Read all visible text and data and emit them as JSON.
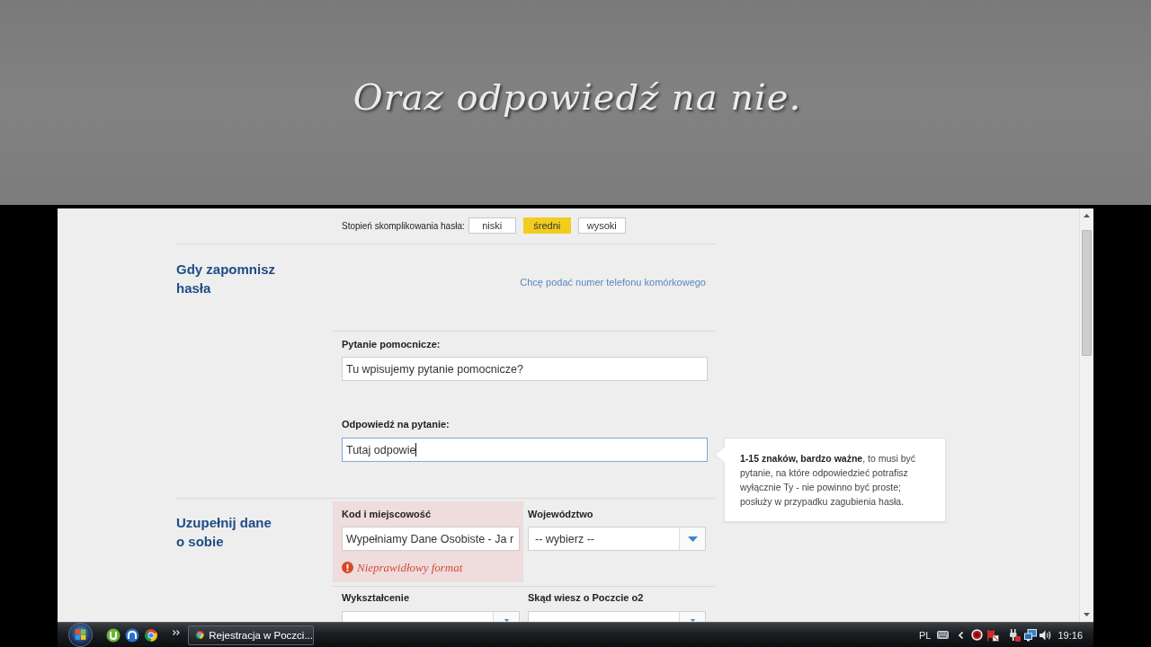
{
  "caption": {
    "text": "Oraz odpowiedź na nie."
  },
  "password_strength": {
    "label": "Stopień skomplikowania hasła:",
    "levels": [
      {
        "label": "niski",
        "selected": false
      },
      {
        "label": "średni",
        "selected": true
      },
      {
        "label": "wysoki",
        "selected": false
      }
    ]
  },
  "recovery_section": {
    "heading": "Gdy zapomnisz hasła",
    "phone_link": "Chcę podać numer telefonu komórkowego",
    "fields": [
      {
        "label": "Pytanie pomocnicze:",
        "value": "Tu wpisujemy pytanie pomocnicze?",
        "focused": false
      },
      {
        "label": "Odpowiedź na pytanie:",
        "value": "Tutaj odpowie",
        "focused": true,
        "tooltip": "**1-15 znaków, bardzo ważne**, to musi być pytanie, na które odpowiedzieć potrafisz wyłącznie Ty - nie powinno być proste; posłuży w przypadku zagubienia hasła."
      }
    ]
  },
  "personal_section": {
    "heading": "Uzupełnij dane o sobie",
    "rows": [
      [
        {
          "kind": "text",
          "label": "Kod i miejscowość",
          "value": "Wypełniamy Dane Osobiste - Ja r",
          "error": "Nieprawidłowy format"
        },
        {
          "kind": "select",
          "label": "Województwo",
          "value": "-- wybierz --"
        }
      ],
      [
        {
          "kind": "select",
          "label": "Wykształcenie"
        },
        {
          "kind": "select",
          "label": "Skąd wiesz o Poczcie o2"
        }
      ]
    ]
  },
  "taskbar": {
    "window_button": "Rejestracja w Poczci...",
    "language": "PL",
    "clock": "19:16"
  }
}
